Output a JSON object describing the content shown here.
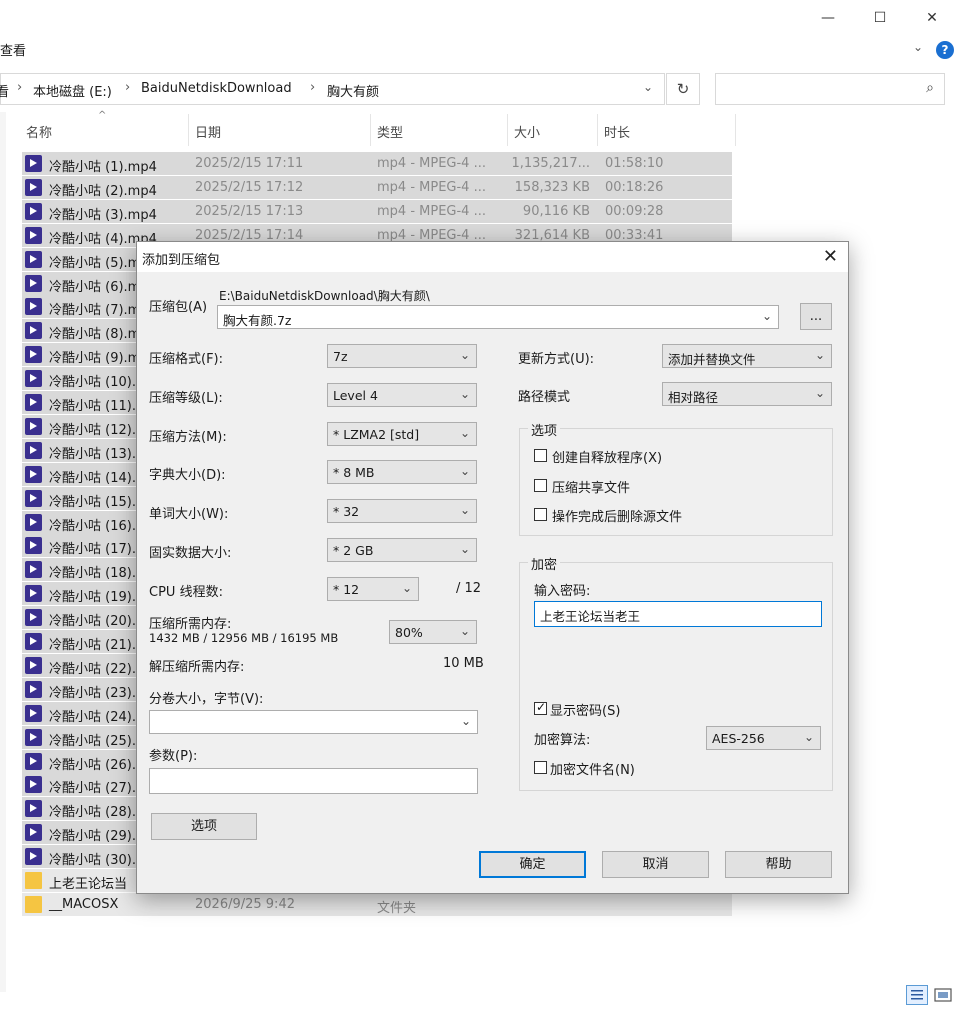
{
  "window": {
    "ribbon_label": "查看",
    "controls": {
      "minimize": "—",
      "maximize": "☐",
      "close": "✕"
    }
  },
  "address": {
    "crumbs": [
      "看",
      "本地磁盘 (E:)",
      "BaiduNetdiskDownload",
      "胸大有颜"
    ],
    "separator": "›"
  },
  "columns": [
    "名称",
    "日期",
    "类型",
    "大小",
    "时长"
  ],
  "files": [
    {
      "name": "冷酷小咕 (1).mp4",
      "date": "2025/2/15 17:11",
      "type": "mp4 - MPEG-4 ...",
      "size": "1,135,217...",
      "duration": "01:58:10",
      "icon": "video"
    },
    {
      "name": "冷酷小咕 (2).mp4",
      "date": "2025/2/15 17:12",
      "type": "mp4 - MPEG-4 ...",
      "size": "158,323 KB",
      "duration": "00:18:26",
      "icon": "video"
    },
    {
      "name": "冷酷小咕 (3).mp4",
      "date": "2025/2/15 17:13",
      "type": "mp4 - MPEG-4 ...",
      "size": "90,116 KB",
      "duration": "00:09:28",
      "icon": "video"
    },
    {
      "name": "冷酷小咕 (4).mp4",
      "date": "2025/2/15 17:14",
      "type": "mp4 - MPEG-4 ...",
      "size": "321,614 KB",
      "duration": "00:33:41",
      "icon": "video"
    },
    {
      "name": "冷酷小咕 (5).m",
      "date": "",
      "type": "",
      "size": "",
      "duration": "",
      "icon": "video"
    },
    {
      "name": "冷酷小咕 (6).m",
      "date": "",
      "type": "",
      "size": "",
      "duration": "",
      "icon": "video"
    },
    {
      "name": "冷酷小咕 (7).m",
      "date": "",
      "type": "",
      "size": "",
      "duration": "",
      "icon": "video"
    },
    {
      "name": "冷酷小咕 (8).m",
      "date": "",
      "type": "",
      "size": "",
      "duration": "",
      "icon": "video"
    },
    {
      "name": "冷酷小咕 (9).m",
      "date": "",
      "type": "",
      "size": "",
      "duration": "",
      "icon": "video"
    },
    {
      "name": "冷酷小咕 (10).",
      "date": "",
      "type": "",
      "size": "",
      "duration": "",
      "icon": "video"
    },
    {
      "name": "冷酷小咕 (11).",
      "date": "",
      "type": "",
      "size": "",
      "duration": "",
      "icon": "video"
    },
    {
      "name": "冷酷小咕 (12).",
      "date": "",
      "type": "",
      "size": "",
      "duration": "",
      "icon": "video"
    },
    {
      "name": "冷酷小咕 (13).",
      "date": "",
      "type": "",
      "size": "",
      "duration": "",
      "icon": "video"
    },
    {
      "name": "冷酷小咕 (14).",
      "date": "",
      "type": "",
      "size": "",
      "duration": "",
      "icon": "video"
    },
    {
      "name": "冷酷小咕 (15).",
      "date": "",
      "type": "",
      "size": "",
      "duration": "",
      "icon": "video"
    },
    {
      "name": "冷酷小咕 (16).",
      "date": "",
      "type": "",
      "size": "",
      "duration": "",
      "icon": "video"
    },
    {
      "name": "冷酷小咕 (17).",
      "date": "",
      "type": "",
      "size": "",
      "duration": "",
      "icon": "video"
    },
    {
      "name": "冷酷小咕 (18).",
      "date": "",
      "type": "",
      "size": "",
      "duration": "",
      "icon": "video"
    },
    {
      "name": "冷酷小咕 (19).",
      "date": "",
      "type": "",
      "size": "",
      "duration": "",
      "icon": "video"
    },
    {
      "name": "冷酷小咕 (20).",
      "date": "",
      "type": "",
      "size": "",
      "duration": "",
      "icon": "video"
    },
    {
      "name": "冷酷小咕 (21).",
      "date": "",
      "type": "",
      "size": "",
      "duration": "",
      "icon": "video"
    },
    {
      "name": "冷酷小咕 (22).",
      "date": "",
      "type": "",
      "size": "",
      "duration": "",
      "icon": "video"
    },
    {
      "name": "冷酷小咕 (23).",
      "date": "",
      "type": "",
      "size": "",
      "duration": "",
      "icon": "video"
    },
    {
      "name": "冷酷小咕 (24).",
      "date": "",
      "type": "",
      "size": "",
      "duration": "",
      "icon": "video"
    },
    {
      "name": "冷酷小咕 (25).",
      "date": "",
      "type": "",
      "size": "",
      "duration": "",
      "icon": "video"
    },
    {
      "name": "冷酷小咕 (26).",
      "date": "",
      "type": "",
      "size": "",
      "duration": "",
      "icon": "video"
    },
    {
      "name": "冷酷小咕 (27).",
      "date": "",
      "type": "",
      "size": "",
      "duration": "",
      "icon": "video"
    },
    {
      "name": "冷酷小咕 (28).",
      "date": "",
      "type": "",
      "size": "",
      "duration": "",
      "icon": "video"
    },
    {
      "name": "冷酷小咕 (29).",
      "date": "",
      "type": "",
      "size": "",
      "duration": "",
      "icon": "video"
    },
    {
      "name": "冷酷小咕 (30).",
      "date": "",
      "type": "",
      "size": "",
      "duration": "",
      "icon": "video"
    },
    {
      "name": "上老王论坛当",
      "date": "",
      "type": "",
      "size": "",
      "duration": "",
      "icon": "folder"
    },
    {
      "name": "__MACOSX",
      "date": "2026/9/25 9:42",
      "type": "文件夹",
      "size": "",
      "duration": "",
      "icon": "folder"
    }
  ],
  "dialog": {
    "title": "添加到压缩包",
    "archive_label": "压缩包(A)",
    "archive_path": "E:\\BaiduNetdiskDownload\\胸大有颜\\",
    "archive_name": "胸大有颜.7z",
    "browse_label": "...",
    "format_label": "压缩格式(F):",
    "format_value": "7z",
    "level_label": "压缩等级(L):",
    "level_value": "Level 4",
    "method_label": "压缩方法(M):",
    "method_value": "* LZMA2 [std]",
    "dict_label": "字典大小(D):",
    "dict_value": "* 8 MB",
    "word_label": "单词大小(W):",
    "word_value": "* 32",
    "solid_label": "固实数据大小:",
    "solid_value": "* 2 GB",
    "threads_label": "CPU 线程数:",
    "threads_value": "* 12",
    "threads_total": "/ 12",
    "mem_comp_label": "压缩所需内存:",
    "mem_comp_value": "1432 MB / 12956 MB / 16195 MB",
    "mem_percent": "80%",
    "mem_decomp_label": "解压缩所需内存:",
    "mem_decomp_value": "10 MB",
    "split_label": "分卷大小，字节(V):",
    "split_value": "",
    "params_label": "参数(P):",
    "params_value": "",
    "options_button": "选项",
    "update_label": "更新方式(U):",
    "update_value": "添加并替换文件",
    "path_label": "路径模式",
    "path_value": "相对路径",
    "options_group": "选项",
    "opt_sfx": "创建自释放程序(X)",
    "opt_shared": "压缩共享文件",
    "opt_delete": "操作完成后删除源文件",
    "encrypt_group": "加密",
    "password_label": "输入密码:",
    "password_value": "上老王论坛当老王",
    "show_password": "显示密码(S)",
    "enc_method_label": "加密算法:",
    "enc_method_value": "AES-256",
    "encrypt_names": "加密文件名(N)",
    "ok_button": "确定",
    "cancel_button": "取消",
    "help_button": "帮助"
  }
}
